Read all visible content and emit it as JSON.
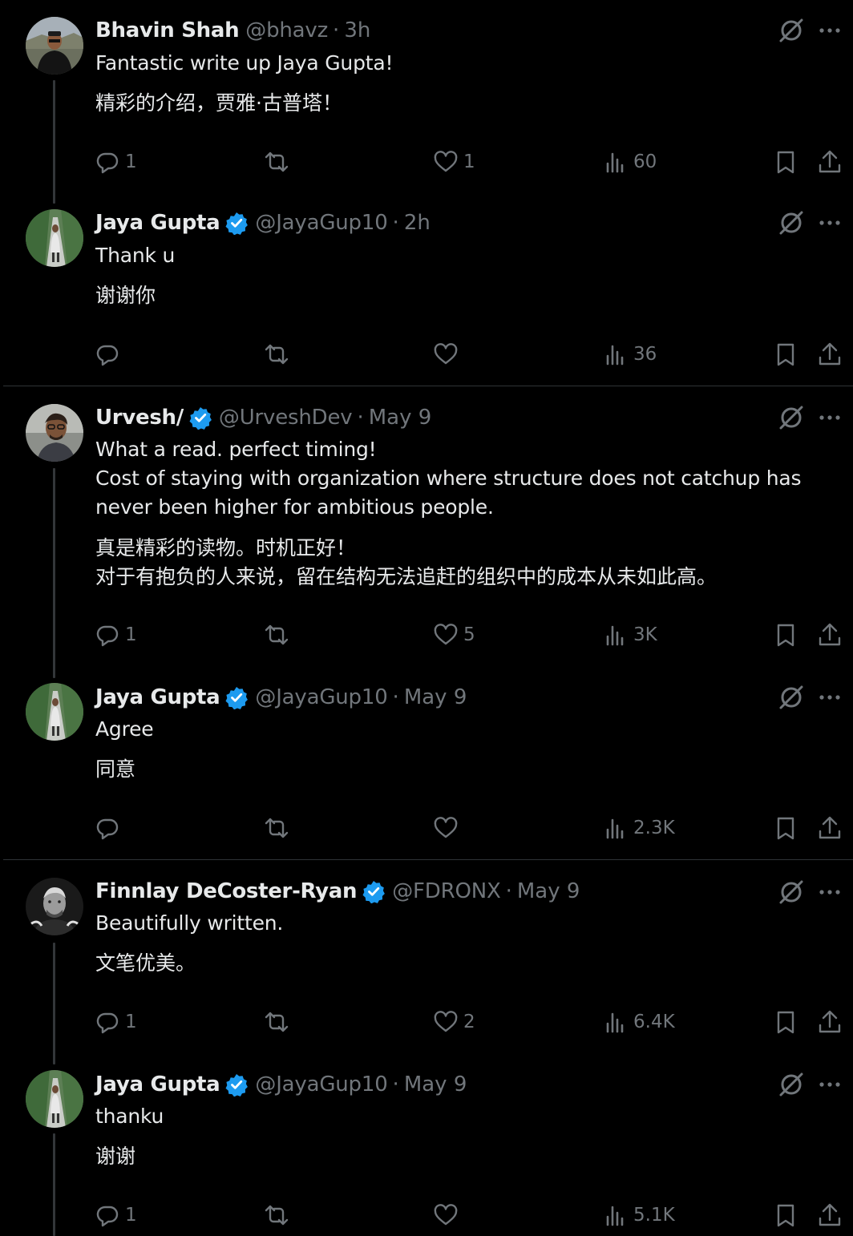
{
  "replies": [
    {
      "name": "Bhavin Shah",
      "verified": false,
      "handle": "@bhavz",
      "separator": "·",
      "time": "3h",
      "text": "Fantastic write up Jaya Gupta!",
      "translation": "精彩的介绍，贾雅·古普塔！",
      "counts": {
        "replies": "1",
        "retweets": "",
        "likes": "1",
        "views": "60"
      }
    },
    {
      "name": "Jaya Gupta",
      "verified": true,
      "handle": "@JayaGup10",
      "separator": "·",
      "time": "2h",
      "text": "Thank u",
      "translation": "谢谢你",
      "counts": {
        "replies": "",
        "retweets": "",
        "likes": "",
        "views": "36"
      }
    },
    {
      "name": "Urvesh/",
      "verified": true,
      "handle": "@UrveshDev",
      "separator": "·",
      "time": "May 9",
      "text": "What a read. perfect timing!\nCost of staying with organization where structure does not catchup has never been higher for ambitious people.",
      "translation": "真是精彩的读物。时机正好！\n对于有抱负的人来说，留在结构无法追赶的组织中的成本从未如此高。",
      "counts": {
        "replies": "1",
        "retweets": "",
        "likes": "5",
        "views": "3K"
      }
    },
    {
      "name": "Jaya Gupta",
      "verified": true,
      "handle": "@JayaGup10",
      "separator": "·",
      "time": "May 9",
      "text": "Agree",
      "translation": "同意",
      "counts": {
        "replies": "",
        "retweets": "",
        "likes": "",
        "views": "2.3K"
      }
    },
    {
      "name": "Finnlay DeCoster-Ryan",
      "verified": true,
      "handle": "@FDRONX",
      "separator": "·",
      "time": "May 9",
      "text": "Beautifully written.",
      "translation": "文笔优美。",
      "counts": {
        "replies": "1",
        "retweets": "",
        "likes": "2",
        "views": "6.4K"
      }
    },
    {
      "name": "Jaya Gupta",
      "verified": true,
      "handle": "@JayaGup10",
      "separator": "·",
      "time": "May 9",
      "text": "thanku",
      "translation": "谢谢",
      "counts": {
        "replies": "1",
        "retweets": "",
        "likes": "",
        "views": "5.1K"
      }
    }
  ],
  "colors": {
    "background": "#000000",
    "text": "#e7e9ea",
    "muted": "#71767b",
    "verified": "#1d9bf0",
    "divider": "#2f3336",
    "thread": "#333639"
  },
  "icons": {
    "reply": "speech-bubble",
    "retweet": "two-arrows-loop",
    "like": "heart-outline",
    "views": "bar-chart",
    "bookmark": "bookmark-outline",
    "share": "upload-arrow",
    "grok": "slashed-circle",
    "more": "horizontal-ellipsis",
    "verified": "blue-check-badge"
  }
}
